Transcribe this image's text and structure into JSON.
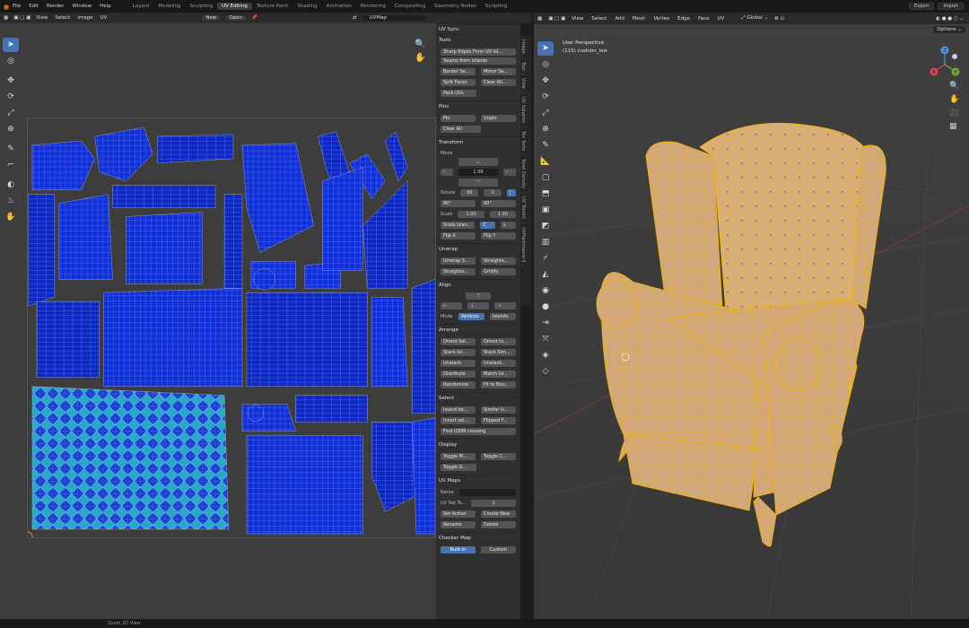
{
  "topbar": {
    "menu": [
      "File",
      "Edit",
      "Render",
      "Window",
      "Help"
    ],
    "workspaces": [
      "Layout",
      "Modeling",
      "Sculpting",
      "UV Editing",
      "Texture Paint",
      "Shading",
      "Animation",
      "Rendering",
      "Compositing",
      "Geometry Nodes",
      "Scripting"
    ],
    "active_workspace": "UV Editing",
    "export_label": "Export",
    "import_label": "Import"
  },
  "uv_header": {
    "menus": [
      "View",
      "Select",
      "Image",
      "UV"
    ],
    "new_label": "New",
    "open_label": "Open",
    "uvmap_field": "UVMap"
  },
  "npanel": {
    "uv_sync": "UV Sync",
    "tools_head": "Tools",
    "tools": [
      "Sharp Edges From UV Isl...",
      "Seams from Islands"
    ],
    "tools_row1": [
      "Border Se...",
      "Mirror Se..."
    ],
    "tools_row2": [
      "Split Faces",
      "Clear All..."
    ],
    "pack": "Pack UVs",
    "pins_head": "Pins",
    "pins_row": [
      "Pin",
      "Unpin"
    ],
    "clear_all": "Clear All",
    "transform_head": "Transform",
    "move_label": "Move",
    "move_value": "1.00",
    "rotate_label": "Rotate",
    "rotate_vals": [
      "90",
      "0"
    ],
    "rot_angles": [
      "90°",
      "90°"
    ],
    "scale_label": "Scale",
    "scale_vals": [
      "1.00",
      "1.00"
    ],
    "scale_islands": "Scale Islands",
    "scale_islands_row": [
      "C",
      "L"
    ],
    "flip_row": [
      "Flip X",
      "Flip Y"
    ],
    "unwrap_head": "Unwrap",
    "unwrap_row1": [
      "Unwrap S...",
      "Straighte..."
    ],
    "unwrap_row2": [
      "Straighte...",
      "Gridify"
    ],
    "align_head": "Align",
    "mode_label": "Mode",
    "mode_opts": [
      "Vertices",
      "Islands"
    ],
    "arrange_head": "Arrange",
    "arrange_rows": [
      [
        "Orient Sel...",
        "Orient to..."
      ],
      [
        "Stack Isl...",
        "Stack Sim..."
      ],
      [
        "Unstack",
        "Unstack..."
      ],
      [
        "Distribute",
        "Match Isl..."
      ],
      [
        "Randomize",
        "Fit to Bou..."
      ]
    ],
    "select_head": "Select",
    "select_rows": [
      [
        "Island bo...",
        "Similar Is..."
      ],
      [
        "Invert sel...",
        "Flipped F..."
      ]
    ],
    "find_udim": "Find UDIM crossing",
    "display_head": "Display",
    "display_row": [
      "Toggle M...",
      "Toggle C..."
    ],
    "display_single": "Toggle G...",
    "uvmaps_head": "UV Maps",
    "name_label": "Name",
    "uvset_label": "UV Set To...",
    "uvset_value": "1",
    "uvmaps_row1": [
      "Set Active",
      "Create New"
    ],
    "uvmaps_row2": [
      "Rename",
      "Delete"
    ],
    "checker_head": "Checker Map",
    "checker_opts": [
      "Built-in",
      "Custom"
    ]
  },
  "vtabs": [
    "Image",
    "Tool",
    "View",
    "UV Squares",
    "Tex Tools",
    "Texel Density",
    "UV Toolkit",
    "UVPackmaster3"
  ],
  "viewport": {
    "menus": [
      "View",
      "Select",
      "Add",
      "Mesh",
      "Vertex",
      "Edge",
      "Face",
      "UV"
    ],
    "transform": "Global",
    "options": "Options",
    "perspective": "User Perspective",
    "object": "(115) cushion_low"
  },
  "status": {
    "text": "Zoom 2D View"
  },
  "colors": {
    "uv_blue": "#0b2fd6",
    "uv_wire": "#7fa4ff",
    "chair": "#d1a779",
    "wire": "#ffc400",
    "accent": "#4772b3"
  }
}
